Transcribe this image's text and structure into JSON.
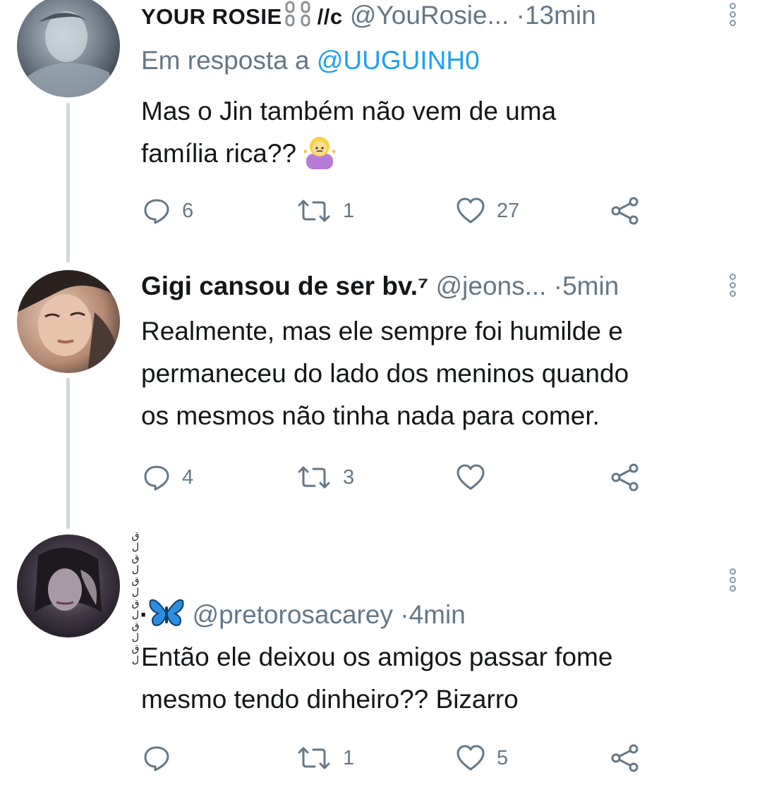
{
  "tweets": [
    {
      "name": "YOUR ROSIE",
      "name_suffix": "//c",
      "handle": "@YouRosie...",
      "separator": "·",
      "time": "13min",
      "reply_prefix": "Em resposta a",
      "reply_to": "@UUGUINH0",
      "text_line1": "Mas o Jin também não vem de uma",
      "text_line2": "família rica??",
      "reply_count": "6",
      "retweet_count": "1",
      "like_count": "27"
    },
    {
      "name": "Gigi cansou de ser bv.⁷",
      "handle": "@jeons...",
      "separator": "·",
      "time": "5min",
      "text_line1": "Realmente, mas ele sempre foi humilde e",
      "text_line2": "permaneceu do lado dos meninos quando",
      "text_line3": "os mesmos não tinha nada para comer.",
      "reply_count": "4",
      "retweet_count": "3",
      "like_count": ""
    },
    {
      "name_glyphs": "لقلقلقلقلقلق",
      "name_prefix": "·",
      "handle": "@pretorosacarey",
      "separator": "·",
      "time": "4min",
      "text_line1": "Então ele deixou os amigos passar fome",
      "text_line2": "mesmo tendo dinheiro?? Bizarro",
      "reply_count": "",
      "retweet_count": "1",
      "like_count": "5"
    }
  ],
  "icons": {
    "reply": "reply-icon",
    "retweet": "retweet-icon",
    "like": "heart-icon",
    "share": "share-icon",
    "more": "more-vertical-icon"
  },
  "colors": {
    "text": "#14171a",
    "secondary": "#657786",
    "link": "#1da1f2",
    "thread_line": "#cfd9de"
  }
}
